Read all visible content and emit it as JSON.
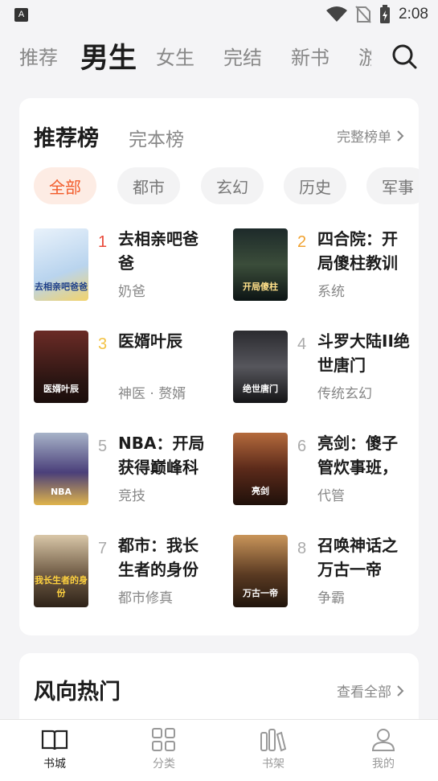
{
  "status": {
    "time": "2:08",
    "app_badge": "A"
  },
  "top_tabs": [
    {
      "label": "推荐"
    },
    {
      "label": "男生"
    },
    {
      "label": "女生"
    },
    {
      "label": "完结"
    },
    {
      "label": "新书"
    },
    {
      "label": "游"
    }
  ],
  "ranking": {
    "title": "推荐榜",
    "tab2": "完本榜",
    "full_link": "完整榜单",
    "chips": [
      "全部",
      "都市",
      "玄幻",
      "历史",
      "军事"
    ],
    "books": [
      {
        "rank": "1",
        "title": "去相亲吧爸爸",
        "tag": "奶爸",
        "cover_text": "去相亲吧爸爸"
      },
      {
        "rank": "2",
        "title": "四合院：开局傻柱教训",
        "tag": "系统",
        "cover_text": "开局傻柱"
      },
      {
        "rank": "3",
        "title": "医婿叶辰",
        "tag": "神医 · 赘婿",
        "cover_text": "医婿叶辰"
      },
      {
        "rank": "4",
        "title": "斗罗大陆II绝世唐门",
        "tag": "传统玄幻",
        "cover_text": "绝世唐门"
      },
      {
        "rank": "5",
        "title": "NBA：开局获得巅峰科",
        "tag": "竞技",
        "cover_text": "NBA"
      },
      {
        "rank": "6",
        "title": "亮剑：傻子管炊事班，",
        "tag": "代管",
        "cover_text": "亮剑"
      },
      {
        "rank": "7",
        "title": "都市：我长生者的身份",
        "tag": "都市修真",
        "cover_text": "我长生者的身份"
      },
      {
        "rank": "8",
        "title": "召唤神话之万古一帝",
        "tag": "争霸",
        "cover_text": "万古一帝"
      }
    ]
  },
  "trending": {
    "title": "风向热门",
    "link": "查看全部"
  },
  "bottom_nav": [
    {
      "label": "书城"
    },
    {
      "label": "分类"
    },
    {
      "label": "书架"
    },
    {
      "label": "我的"
    }
  ]
}
